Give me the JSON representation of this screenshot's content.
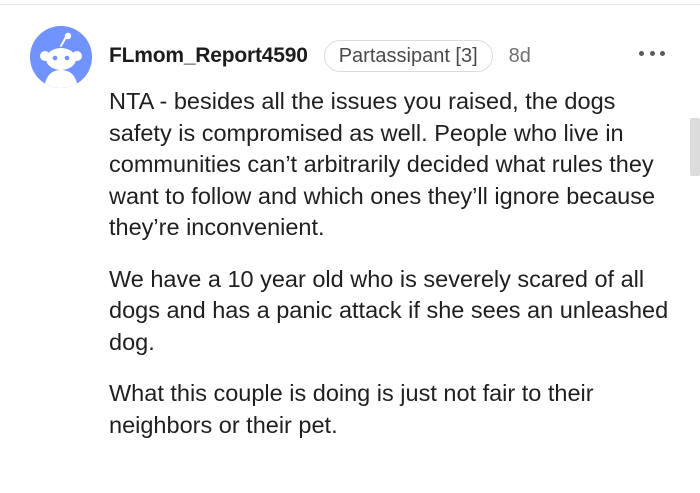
{
  "comment": {
    "author": "FLmom_Report4590",
    "flair": "Partassipant [3]",
    "time_ago": "8d",
    "more_icon": "ellipsis-icon",
    "avatar_icon": "reddit-snoo-avatar-icon",
    "avatar_color": "#7193ff",
    "paragraphs": [
      "NTA - besides all the issues you raised, the dogs safety is compromised as well. People who live in communities can’t arbitrarily decided what rules they want to follow and which ones they’ll ignore because they’re inconvenient.",
      "We have a 10 year old who is severely scared of all dogs and has a panic attack if she sees an unleashed dog.",
      "What this couple is doing is just not fair to their neighbors or their pet."
    ]
  }
}
